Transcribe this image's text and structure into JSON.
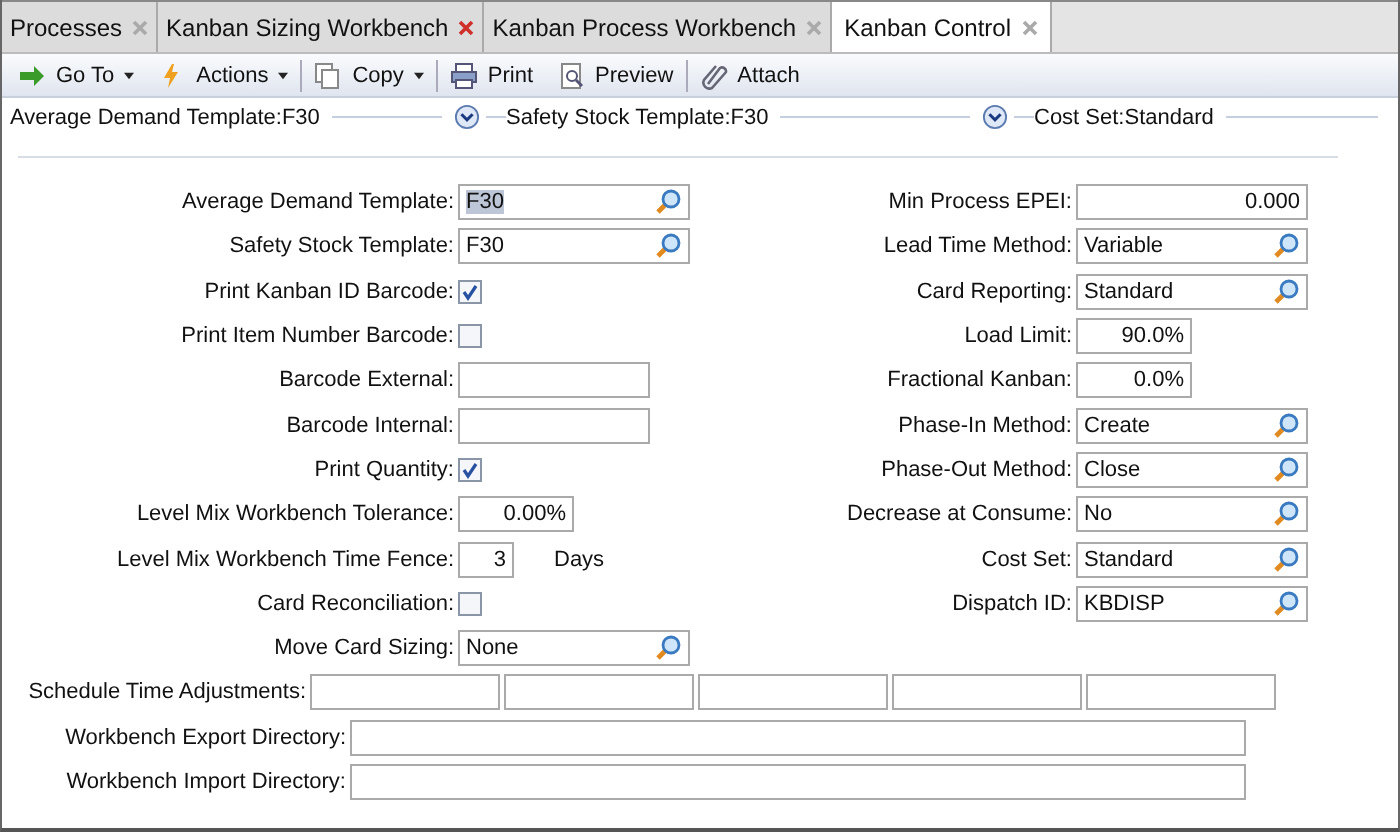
{
  "tabs": [
    {
      "label": "Processes",
      "selected": false,
      "close_hover": false
    },
    {
      "label": "Kanban Sizing Workbench",
      "selected": false,
      "close_hover": true
    },
    {
      "label": "Kanban Process Workbench",
      "selected": false,
      "close_hover": false
    },
    {
      "label": "Kanban Control",
      "selected": true,
      "close_hover": false
    }
  ],
  "toolbar": [
    {
      "label": "Go To",
      "kind": "goto",
      "dropdown": true
    },
    {
      "label": "Actions",
      "kind": "actions",
      "dropdown": true
    },
    {
      "label": "Copy",
      "kind": "copy",
      "dropdown": true
    },
    {
      "label": "Print",
      "kind": "print",
      "dropdown": false
    },
    {
      "label": "Preview",
      "kind": "preview",
      "dropdown": false
    },
    {
      "label": "Attach",
      "kind": "attach",
      "dropdown": false
    }
  ],
  "summary": [
    {
      "label": "Average Demand Template:F30",
      "expander": true
    },
    {
      "label": "Safety Stock Template:F30",
      "expander": true
    },
    {
      "label": "Cost Set:Standard",
      "expander": false
    }
  ],
  "left_fields": [
    {
      "label": "Average Demand Template:",
      "kind": "lookup",
      "value": "F30",
      "selected": true
    },
    {
      "label": "Safety Stock Template:",
      "kind": "lookup",
      "value": "F30"
    },
    {
      "label": "Print Kanban ID Barcode:",
      "kind": "checkbox",
      "checked": true
    },
    {
      "label": "Print Item Number Barcode:",
      "kind": "checkbox",
      "checked": false
    },
    {
      "label": "Barcode External:",
      "kind": "text"
    },
    {
      "label": "Barcode Internal:",
      "kind": "text"
    },
    {
      "label": "Print Quantity:",
      "kind": "checkbox",
      "checked": true
    },
    {
      "label": "Level Mix Workbench Tolerance:",
      "kind": "percent",
      "value": "0.00%"
    },
    {
      "label": "Level Mix Workbench Time Fence:",
      "kind": "count",
      "value": "3",
      "unit": "Days"
    },
    {
      "label": "Card Reconciliation:",
      "kind": "checkbox",
      "checked": false
    },
    {
      "label": "Move Card Sizing:",
      "kind": "lookup",
      "value": "None"
    }
  ],
  "right_fields": [
    {
      "label": "Min Process EPEI:",
      "kind": "decimal",
      "value": "0.000"
    },
    {
      "label": "Lead Time Method:",
      "kind": "lookup",
      "value": "Variable"
    },
    {
      "label": "Card Reporting:",
      "kind": "lookup",
      "value": "Standard"
    },
    {
      "label": "Load Limit:",
      "kind": "percent",
      "value": "90.0%"
    },
    {
      "label": "Fractional Kanban:",
      "kind": "percent",
      "value": "0.0%"
    },
    {
      "label": "Phase-In Method:",
      "kind": "lookup",
      "value": "Create"
    },
    {
      "label": "Phase-Out Method:",
      "kind": "lookup",
      "value": "Close"
    },
    {
      "label": "Decrease at Consume:",
      "kind": "lookup",
      "value": "No"
    },
    {
      "label": "Cost Set:",
      "kind": "lookup",
      "value": "Standard"
    },
    {
      "label": "Dispatch ID:",
      "kind": "lookup",
      "value": "KBDISP"
    }
  ],
  "schedule": {
    "label": "Schedule Time Adjustments:"
  },
  "directories": [
    {
      "label": "Workbench Export Directory:"
    },
    {
      "label": "Workbench Import Directory:"
    }
  ]
}
